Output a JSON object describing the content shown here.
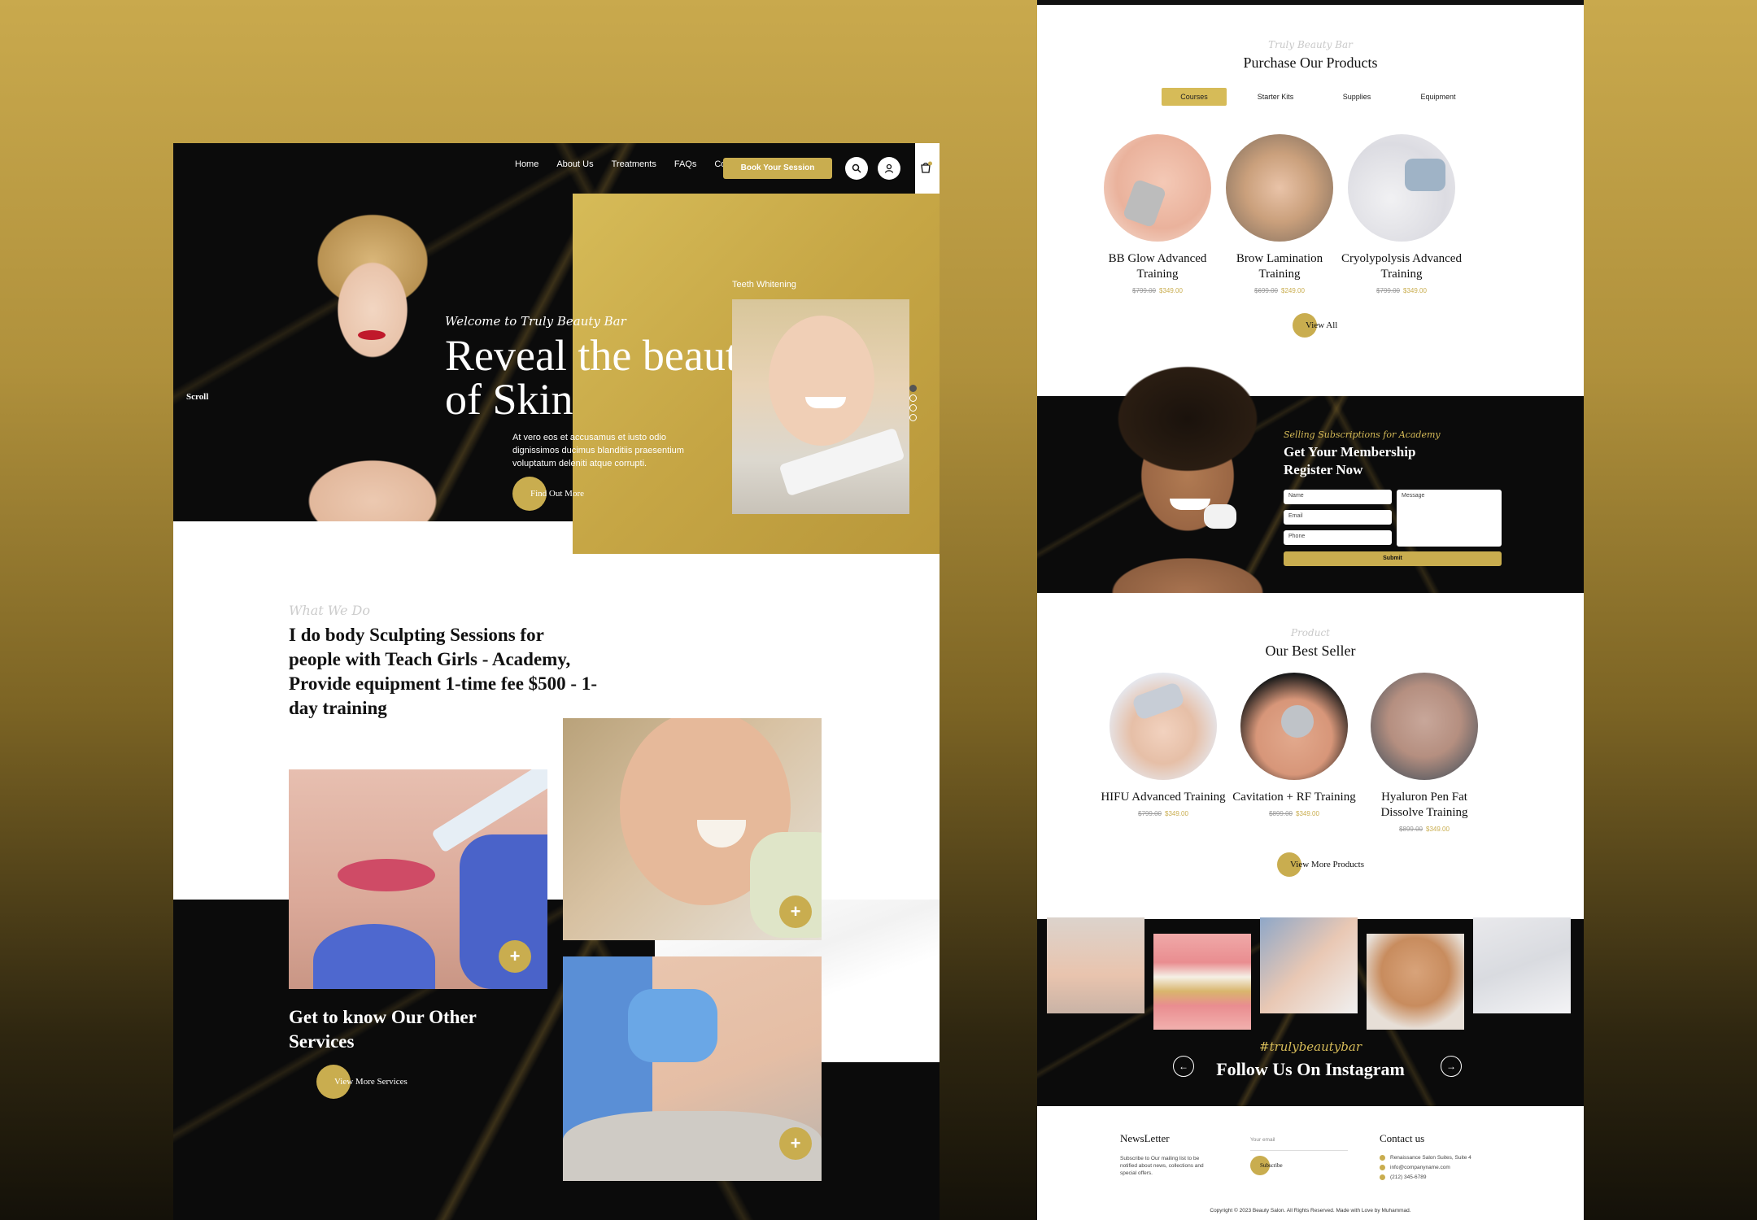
{
  "colors": {
    "gold": "#c9ad4f",
    "gold_light": "#d6bb58",
    "dark": "#0b0b0b",
    "white": "#ffffff"
  },
  "left_page": {
    "nav": {
      "items": [
        "Home",
        "About Us",
        "Treatments",
        "FAQs",
        "Contact"
      ],
      "book_label": "Book Your Session",
      "icons": [
        "search-icon",
        "user-icon",
        "cart-icon"
      ]
    },
    "hero": {
      "scroll_label": "Scroll",
      "script": "Welcome to Truly Beauty Bar",
      "title": "Reveal the beauty of Skin",
      "body": "At vero eos et accusamus et iusto odio dignissimos ducimus blanditiis praesentium voluptatum deleniti atque corrupti.",
      "cta": "Find Out More",
      "slide_label": "Teeth Whitening",
      "slide_count": 4,
      "active_slide": 1
    },
    "what_we_do": {
      "script": "What We Do",
      "title": "I do body Sculpting Sessions for people with Teach Girls - Academy, Provide equipment 1-time fee $500 - 1-day training"
    },
    "services": {
      "title": "Get to know Our Other Services",
      "cta": "View More Services",
      "plus": "+"
    }
  },
  "right_page": {
    "products": {
      "script": "Truly Beauty Bar",
      "title": "Purchase Our Products",
      "tabs": [
        "Courses",
        "Starter Kits",
        "Supplies",
        "Equipment"
      ],
      "active_tab": "Courses",
      "items": [
        {
          "name": "BB Glow Advanced Training",
          "old_price": "$799.00",
          "new_price": "$349.00"
        },
        {
          "name": "Brow Lamination Training",
          "old_price": "$699.00",
          "new_price": "$249.00"
        },
        {
          "name": "Cryolypolysis Advanced Training",
          "old_price": "$799.00",
          "new_price": "$349.00"
        }
      ],
      "view_all": "View All"
    },
    "membership": {
      "script": "Selling Subscriptions for Academy",
      "title": "Get Your Membership Register Now",
      "name_placeholder": "Name",
      "email_placeholder": "Email",
      "phone_placeholder": "Phone",
      "message_placeholder": "Message",
      "submit": "Submit"
    },
    "best_seller": {
      "script": "Product",
      "title": "Our Best Seller",
      "items": [
        {
          "name": "HIFU Advanced Training",
          "old_price": "$799.00",
          "new_price": "$349.00"
        },
        {
          "name": "Cavitation + RF Training",
          "old_price": "$899.00",
          "new_price": "$349.00"
        },
        {
          "name": "Hyaluron Pen Fat Dissolve Training",
          "old_price": "$899.00",
          "new_price": "$349.00"
        }
      ],
      "view_more": "View More Products"
    },
    "instagram": {
      "tag": "#trulybeautybar",
      "title": "Follow Us On Instagram",
      "prev": "←",
      "next": "→"
    },
    "footer": {
      "newsletter_title": "NewsLetter",
      "newsletter_text": "Subscribe to Our mailing list to be notified about news, collections and special offers.",
      "email_placeholder": "Your email",
      "subscribe": "Subscribe",
      "contact_title": "Contact us",
      "address": "Renaissance Salon Suites, Suite 4",
      "email": "info@companyname.com",
      "phone": "(212) 345-6789",
      "copyright": "Copyright © 2023 Beauty Salon. All Rights Reserved. Made with Love by Muhammad."
    }
  }
}
